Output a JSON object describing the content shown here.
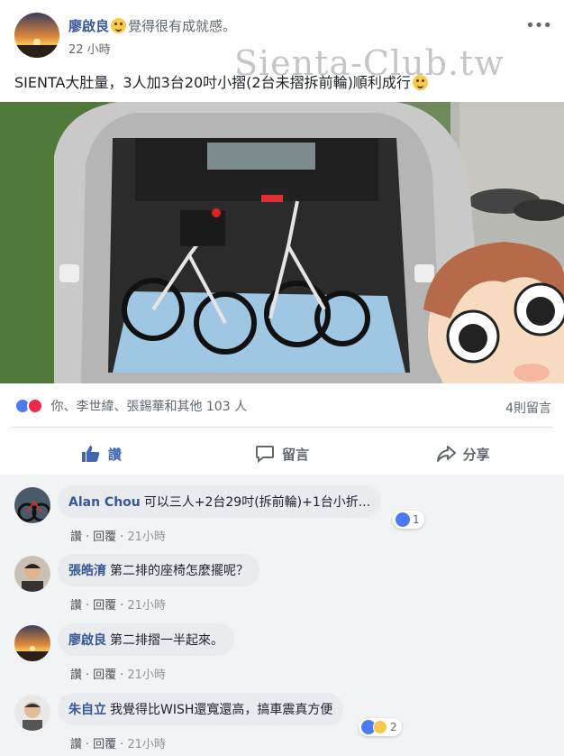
{
  "post": {
    "author": "廖啟良",
    "feeling": "覺得很有成就感。",
    "timestamp": "22 小時",
    "more": "•••",
    "text": "SIENTA大肚量，3人加3台20吋小摺(2台未摺拆前輪)順利成行",
    "watermark": "Sienta-Club.tw"
  },
  "reactions": {
    "summary": "你、李世緯、張錫華和其他 103 人",
    "comment_count": "4則留言"
  },
  "actions": {
    "like": "讚",
    "comment": "留言",
    "share": "分享"
  },
  "comments": [
    {
      "name": "Alan Chou",
      "text": "可以三人+2台29吋(拆前輪)+1台小折...",
      "like": "讚",
      "reply": "回覆",
      "time": "21小時",
      "reaction_count": "1"
    },
    {
      "name": "張皓淯",
      "text": "第二排的座椅怎麼擺呢？",
      "like": "讚",
      "reply": "回覆",
      "time": "21小時"
    },
    {
      "name": "廖啟良",
      "text": "第二排摺一半起來。",
      "like": "讚",
      "reply": "回覆",
      "time": "21小時"
    },
    {
      "name": "朱自立",
      "text": "我覺得比WISH還寬還高，搞車震真方便",
      "like": "讚",
      "reply": "回覆",
      "time": "21小時",
      "reaction_count": "2"
    }
  ],
  "colors": {
    "link": "#385898",
    "like_blue": "#4267b2",
    "background": "#f2f3f5"
  }
}
